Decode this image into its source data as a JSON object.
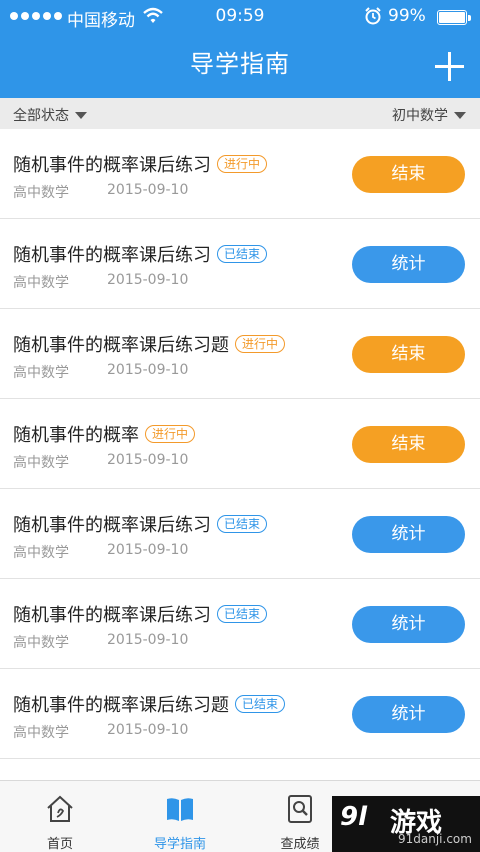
{
  "status_bar": {
    "carrier": "中国移动",
    "time": "09:59",
    "battery": "99%"
  },
  "header": {
    "title": "导学指南"
  },
  "filters": {
    "status": "全部状态",
    "subject": "初中数学"
  },
  "items": [
    {
      "title": "随机事件的概率课后练习",
      "tag": "进行中",
      "subject": "高中数学",
      "date": "2015-09-10",
      "action": "结束"
    },
    {
      "title": "随机事件的概率课后练习",
      "tag": "已结束",
      "subject": "高中数学",
      "date": "2015-09-10",
      "action": "统计"
    },
    {
      "title": "随机事件的概率课后练习题",
      "tag": "进行中",
      "subject": "高中数学",
      "date": "2015-09-10",
      "action": "结束"
    },
    {
      "title": "随机事件的概率",
      "tag": "进行中",
      "subject": "高中数学",
      "date": "2015-09-10",
      "action": "结束"
    },
    {
      "title": "随机事件的概率课后练习",
      "tag": "已结束",
      "subject": "高中数学",
      "date": "2015-09-10",
      "action": "统计"
    },
    {
      "title": "随机事件的概率课后练习",
      "tag": "已结束",
      "subject": "高中数学",
      "date": "2015-09-10",
      "action": "统计"
    },
    {
      "title": "随机事件的概率课后练习题",
      "tag": "已结束",
      "subject": "高中数学",
      "date": "2015-09-10",
      "action": "统计"
    }
  ],
  "tabs": [
    {
      "label": "首页",
      "icon": "home-icon"
    },
    {
      "label": "导学指南",
      "icon": "book-icon"
    },
    {
      "label": "查成绩",
      "icon": "search-score-icon"
    },
    {
      "label": "",
      "icon": "profile-icon"
    }
  ],
  "watermark": {
    "logo": "9l",
    "text": "游戏",
    "url": "91danji.com"
  },
  "colors": {
    "primary": "#2f95e8",
    "in_progress": "#f5a023",
    "finished": "#3a98ea"
  }
}
